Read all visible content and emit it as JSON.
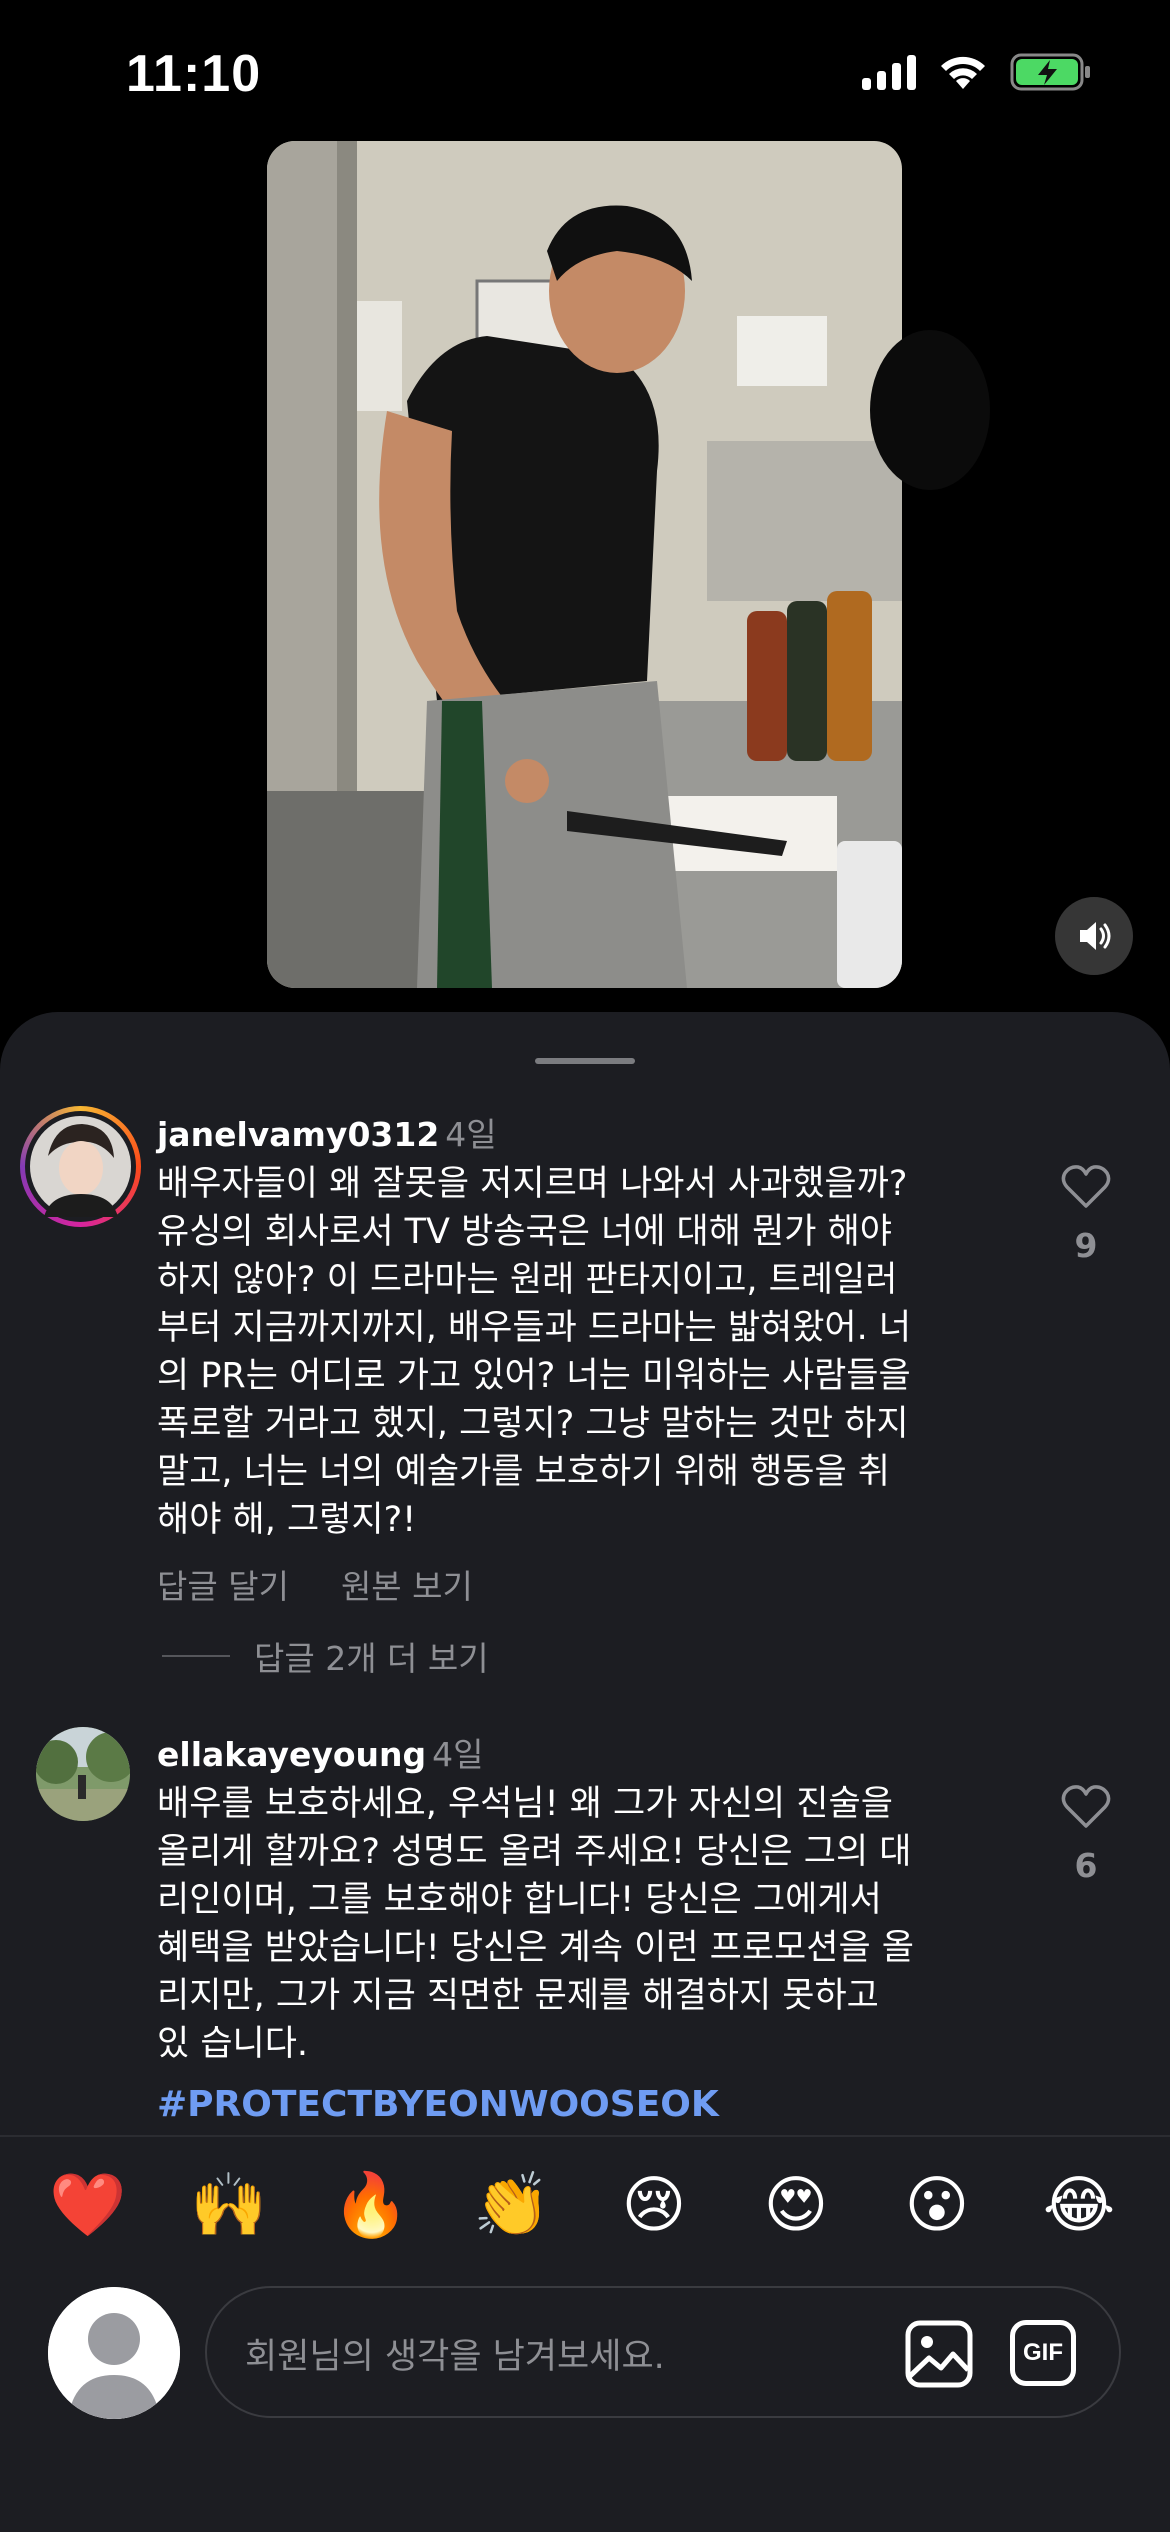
{
  "status_bar": {
    "time": "11:10"
  },
  "comments": [
    {
      "username": "janelvamy0312",
      "age": "4일",
      "text": "배우자들이 왜 잘못을 저지르며 나와서 사과했을까?\n유싱의 회사로서 TV 방송국은 너에 대해 뭔가 해야\n하지 않아? 이 드라마는 원래 판타지이고, 트레일러\n부터 지금까지까지, 배우들과 드라마는 밟혀왔어. 너\n의 PR는 어디로 가고 있어? 너는 미워하는 사람들을\n폭로할 거라고 했지, 그렇지? 그냥 말하는 것만 하지\n말고, 너는 너의 예술가를 보호하기 위해 행동을 취\n해야 해, 그렇지?!",
      "likes": "9",
      "reply_label": "답글 달기",
      "original_label": "원본 보기",
      "more_replies": "답글 2개 더 보기"
    },
    {
      "username": "ellakayeyoung",
      "age": "4일",
      "text": "배우를 보호하세요, 우석님! 왜 그가 자신의 진술을\n올리게 할까요? 성명도 올려 주세요! 당신은 그의 대\n리인이며, 그를 보호해야 합니다! 당신은 그에게서\n혜택을 받았습니다! 당신은 계속 이런 프로모션을 올\n리지만, 그가 지금 직면한 문제를 해결하지 못하고\n있 습니다.",
      "likes": "6",
      "hashtag": "#PROTECTBYEONWOOSEOK"
    }
  ],
  "reactions": [
    "❤️",
    "🙌",
    "🔥",
    "👏",
    "😢",
    "😍",
    "😮",
    "😂"
  ],
  "composer": {
    "placeholder": "회원님의 생각을 남겨보세요.",
    "gif_label": "GIF"
  },
  "colors": {
    "sheet_bg": "#1c1d22",
    "hashtag": "#6f9cf2",
    "muted_text": "#8e8f94",
    "battery": "#4cd964"
  },
  "icons": [
    "signal-icon",
    "wifi-icon",
    "battery-charging-icon",
    "speaker-icon",
    "heart-outline-icon",
    "image-icon",
    "gif-icon"
  ]
}
